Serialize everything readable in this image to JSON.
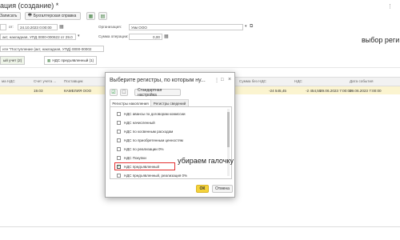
{
  "window": {
    "title": "ация (создание) *"
  },
  "toolbar": {
    "post_label": "Записать",
    "accounting_ref_label": "Бухгалтерская справка"
  },
  "form": {
    "from_label": "от:",
    "date_value": "24.10.2023  0:00:00",
    "org_label": "Организация:",
    "org_value": "Укм ООО",
    "doc_value": "акт, накладная, УПД 0000-000622 от 29.0",
    "op_amount_label": "Сумма операции:",
    "op_amount_value": "0,00",
    "basis_value": "нте \"Поступление (акт, накладная, УПД) 0000-00002"
  },
  "tabs": [
    {
      "label": "ый учет (2)"
    },
    {
      "label": "НДС предъявленный (1)"
    }
  ],
  "table": {
    "headers": [
      "ма НДС",
      "Счет учета ...",
      "Поставщик",
      "Сумма без НДС",
      "НДС",
      "Дата события"
    ],
    "row": {
      "account": "19.03",
      "supplier": "КАМЕЛИЯ ООО",
      "amount": "-24 545,45",
      "vat": "-2 454,55",
      "date1": "29.06.2023 7:00:00",
      "date2": "29.06.2023 7:00:00"
    }
  },
  "annotations": {
    "top_right": "выбор реги",
    "remove_check": "убираем галочку"
  },
  "dialog": {
    "title": "Выберите регистры, по которым ну...",
    "standard_setting": "Стандартная настройка",
    "tabs": [
      "Регистры накопления",
      "Регистры сведений"
    ],
    "items": [
      {
        "label": "НДС авансы по договорам комиссии",
        "checked": false
      },
      {
        "label": "НДС начисленный",
        "checked": false
      },
      {
        "label": "НДС по косвенным расходам",
        "checked": false
      },
      {
        "label": "НДС по приобретенным ценностям",
        "checked": false
      },
      {
        "label": "НДС по реализации 0%",
        "checked": false
      },
      {
        "label": "НДС Покупки",
        "checked": false
      },
      {
        "label": "НДС предъявленный",
        "checked": true
      },
      {
        "label": "НДС предъявленный, реализация 0%",
        "checked": false
      }
    ],
    "ok_label": "ОК",
    "cancel_label": "Отмена"
  },
  "colors": {
    "accent_yellow": "#f5d33a",
    "row_highlight": "#fbf4d0",
    "red_box": "#e3302f",
    "green": "#2e9e44"
  }
}
